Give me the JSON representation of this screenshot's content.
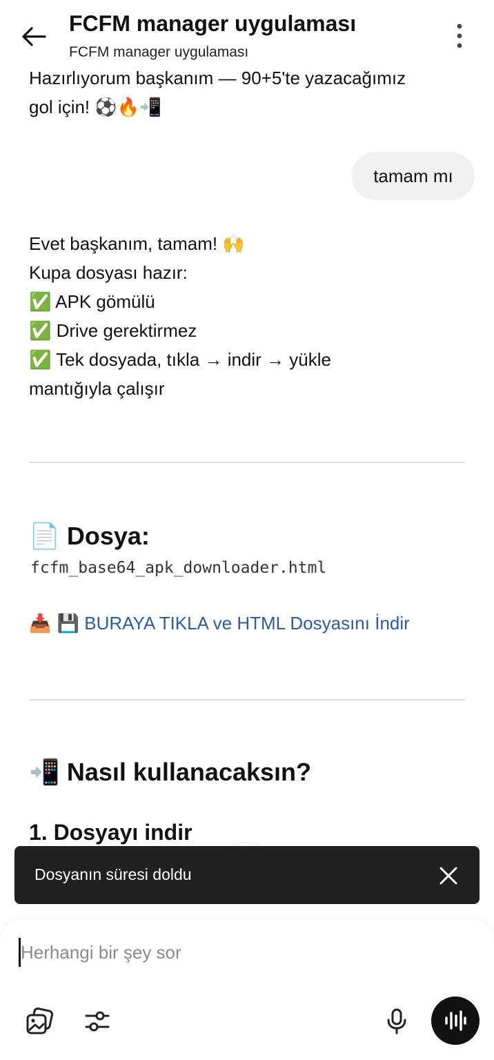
{
  "header": {
    "title": "FCFM manager uygulaması",
    "subtitle": "FCFM manager uygulaması"
  },
  "chat": {
    "partial_message_line1": "Hazırlıyorum başkanım — 90+5'te yazacağımız",
    "partial_message_line2": "gol için! ⚽🔥📲",
    "user_bubble": "tamam mı",
    "reply": {
      "line1": "Evet başkanım, tamam! 🙌",
      "line2": "Kupa dosyası hazır:",
      "line3": "✅ APK gömülü",
      "line4": "✅ Drive gerektirmez",
      "line5": "✅ Tek dosyada, tıkla → indir → yükle",
      "line6": "mantığıyla çalışır"
    },
    "file_section": {
      "icon": "📄",
      "heading": "Dosya:",
      "filename": "fcfm_base64_apk_downloader.html",
      "link_icons": "📥 💾",
      "link_text": "BURAYA TIKLA ve HTML Dosyasını İndir"
    },
    "howto_section": {
      "icon": "📲",
      "heading": "Nasıl kullanacaksın?",
      "step1": "1. Dosyayı indir"
    }
  },
  "snackbar": {
    "message": "Dosyanın süresi doldu"
  },
  "composer": {
    "placeholder": "Herhangi bir şey sor"
  },
  "colors": {
    "link": "#2b5aa8",
    "snackbar_bg": "#202020",
    "bubble_bg": "#f0f0f0",
    "voice_button_bg": "#111111"
  }
}
